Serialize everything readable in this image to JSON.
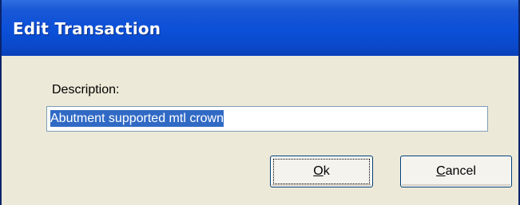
{
  "window": {
    "title": "Edit Transaction"
  },
  "form": {
    "description_label": "Description:",
    "description_value": "Abutment supported mtl crown"
  },
  "buttons": {
    "ok_mnemonic": "O",
    "ok_rest": "k",
    "cancel_mnemonic": "C",
    "cancel_rest": "ancel"
  },
  "colors": {
    "titlebar": "#0b50d8",
    "dialog_bg": "#ece9d8",
    "selection": "#316ac5"
  }
}
